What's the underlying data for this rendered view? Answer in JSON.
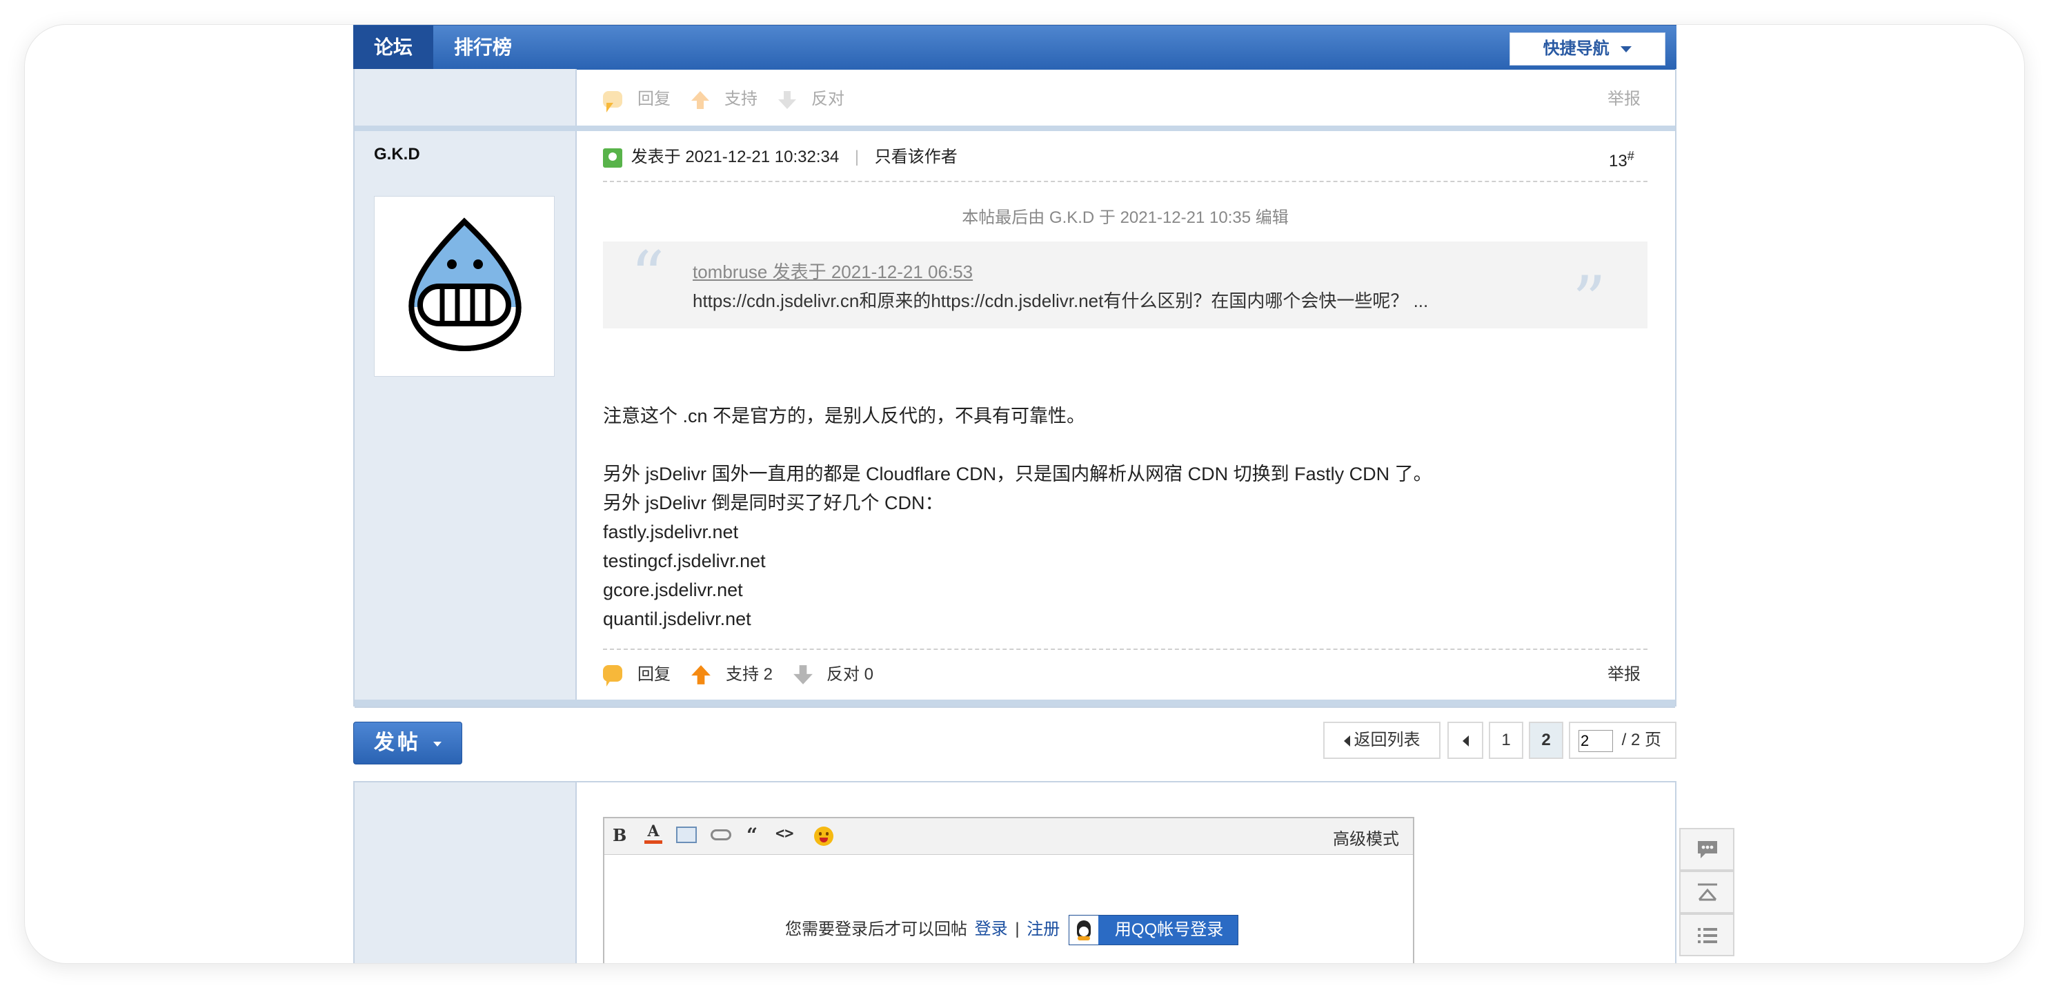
{
  "nav": {
    "tab_forum": "论坛",
    "tab_ranking": "排行榜",
    "quick_nav": "快捷导航"
  },
  "prev_post": {
    "reply": "回复",
    "support": "支持",
    "oppose": "反对",
    "report": "举报"
  },
  "post": {
    "author": "G.K.D",
    "posted_at": "发表于 2021-12-21 10:32:34",
    "separator": "|",
    "only_author": "只看该作者",
    "floor": "13",
    "floor_mark": "#",
    "edit_note": "本帖最后由 G.K.D 于 2021-12-21 10:35 编辑",
    "quote": {
      "header": "tombruse 发表于 2021-12-21 06:53",
      "text": "https://cdn.jsdelivr.cn和原来的https://cdn.jsdelivr.net有什么区别？在国内哪个会快一些呢？ ..."
    },
    "body": [
      "注意这个 .cn 不是官方的，是别人反代的，不具有可靠性。",
      "",
      "另外 jsDelivr 国外一直用的都是 Cloudflare CDN，只是国内解析从网宿 CDN 切换到 Fastly CDN 了。",
      "另外 jsDelivr 倒是同时买了好几个 CDN：",
      "fastly.jsdelivr.net",
      "testingcf.jsdelivr.net",
      "gcore.jsdelivr.net",
      "quantil.jsdelivr.net"
    ],
    "actions": {
      "reply": "回复",
      "support": "支持 2",
      "oppose": "反对 0",
      "report": "举报"
    }
  },
  "toolbar": {
    "new_post": "发帖",
    "back_to_list": "返回列表",
    "page_1": "1",
    "page_2": "2",
    "page_input": "2",
    "page_total": "/ 2 页"
  },
  "editor": {
    "advanced": "高级模式",
    "login_prompt": "您需要登录后才可以回帖",
    "login": "登录",
    "divider": "|",
    "register": "注册",
    "qq_login": "用QQ帐号登录"
  },
  "colors": {
    "nav_blue": "#2a63b3",
    "side_bg": "#e4ebf3",
    "link": "#1b4fa0",
    "support_orange": "#f58a12"
  }
}
